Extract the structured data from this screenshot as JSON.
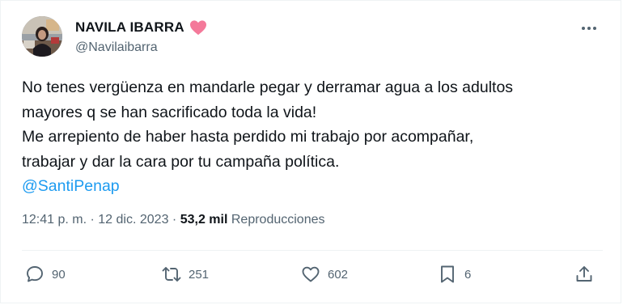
{
  "author": {
    "name": "NAVILA IBARRA",
    "handle": "@Navilaibarra"
  },
  "tweet": {
    "lines": [
      "No tenes vergüenza en mandarle pegar y derramar agua a los adultos",
      "mayores q se han sacrificado toda la vida!",
      "Me arrepiento de haber hasta perdido mi trabajo por acompañar,",
      "trabajar y dar la cara por tu campaña política."
    ],
    "mention": "@SantiPenap"
  },
  "meta": {
    "time": "12:41 p. m.",
    "separator": "·",
    "date": "12 dic. 2023",
    "views_count": "53,2 mil",
    "views_label": "Reproducciones"
  },
  "actions": {
    "replies": "90",
    "retweets": "251",
    "likes": "602",
    "bookmarks": "6"
  },
  "icons": {
    "heart_emoji": "pink-heart-icon",
    "more": "more-icon",
    "reply": "reply-icon",
    "retweet": "retweet-icon",
    "like": "like-icon",
    "bookmark": "bookmark-icon",
    "share": "share-icon"
  },
  "colors": {
    "link": "#1d9bf0",
    "secondary_text": "#536471",
    "heart": "#f4799a"
  }
}
